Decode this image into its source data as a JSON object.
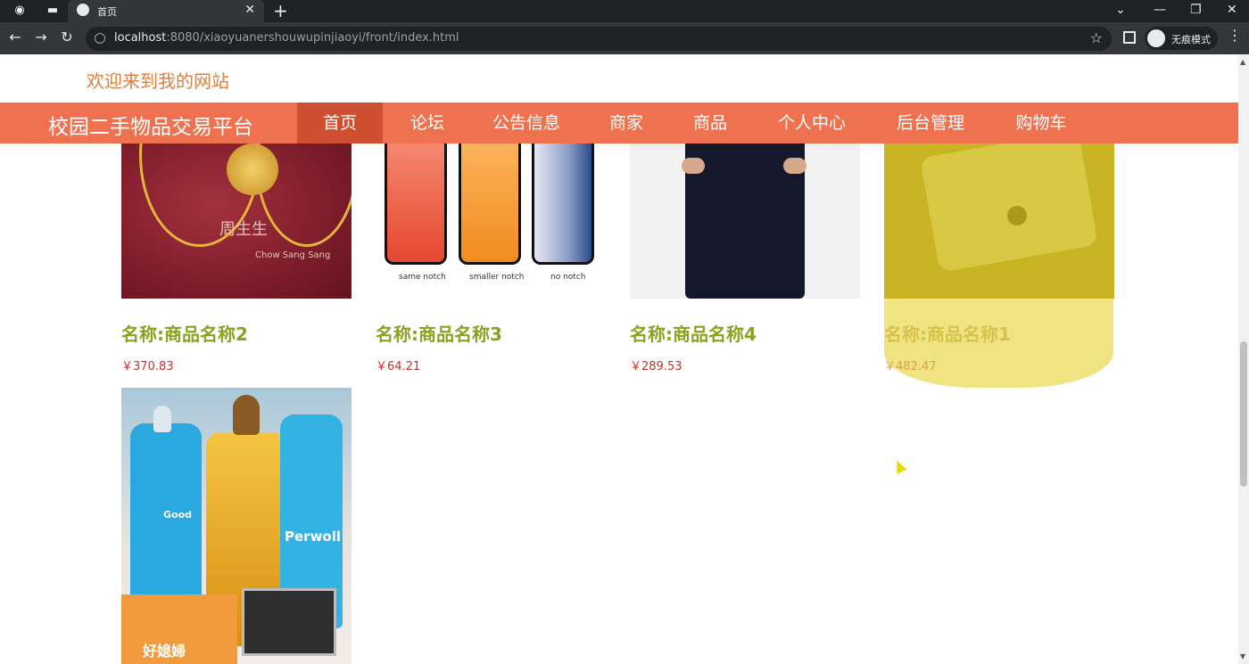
{
  "browser": {
    "tab_title": "首页",
    "url_host": "localhost",
    "url_rest": ":8080/xiaoyuanershouwupinjiaoyi/front/index.html",
    "incognito_label": "无痕模式"
  },
  "header": {
    "welcome": "欢迎来到我的网站",
    "site_title": "校园二手物品交易平台"
  },
  "nav": {
    "items": [
      "首页",
      "论坛",
      "公告信息",
      "商家",
      "商品",
      "个人中心",
      "后台管理",
      "购物车"
    ],
    "active": "首页"
  },
  "products": [
    {
      "name": "名称:商品名称2",
      "price": "￥370.83",
      "image": "gold-jewelry"
    },
    {
      "name": "名称:商品名称3",
      "price": "￥64.21",
      "image": "phones"
    },
    {
      "name": "名称:商品名称4",
      "price": "￥289.53",
      "image": "jacket"
    },
    {
      "name": "名称:商品名称1",
      "price": "￥482.47",
      "image": "laptop"
    }
  ],
  "image_text": {
    "gold_brand": "周生生",
    "gold_brand_sub": "Chow Sang Sang",
    "phone_captions": [
      "same notch",
      "smaller notch",
      "no notch"
    ],
    "detergent_brand": "Perwoll",
    "detergent_box": "好媳婦",
    "detergent_good": "Good"
  },
  "colors": {
    "nav_bg": "#ee7150",
    "nav_active": "#cf4f32",
    "welcome": "#e07f3c",
    "product_name": "#8aa31f",
    "price": "#c8302a"
  }
}
